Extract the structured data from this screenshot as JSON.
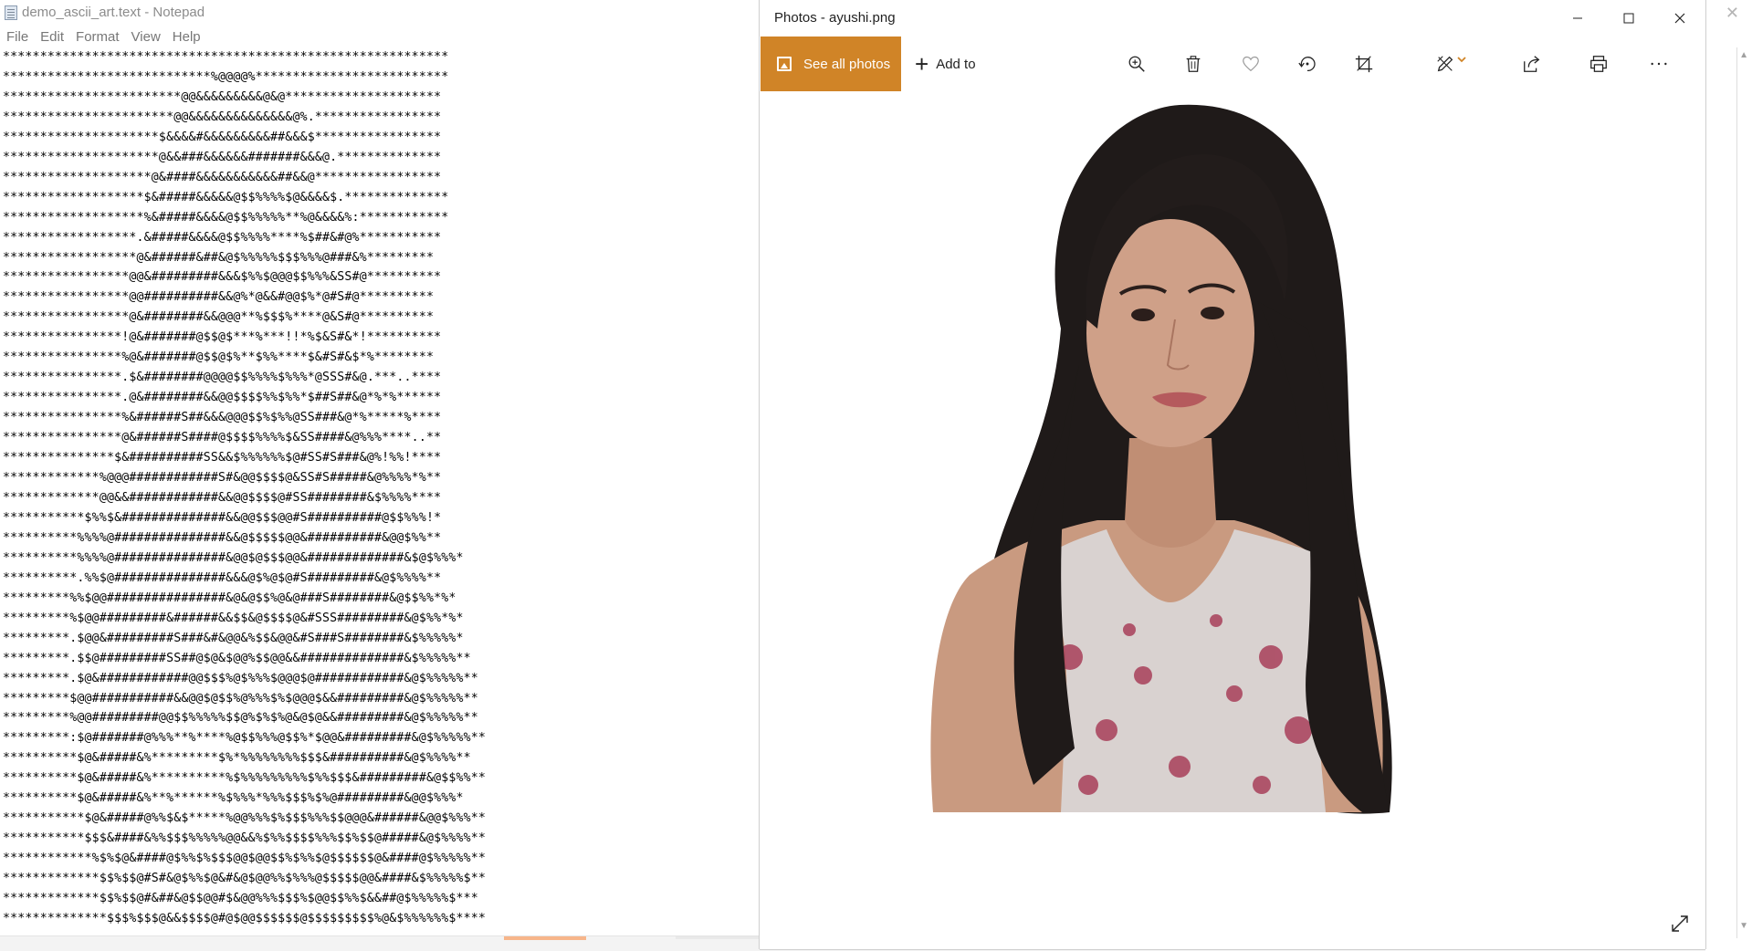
{
  "notepad": {
    "title": "demo_ascii_art.text - Notepad",
    "menu": [
      "File",
      "Edit",
      "Format",
      "View",
      "Help"
    ],
    "lines": [
      "************************************************************",
      "****************************%@@@@%**************************",
      "************************@@&&&&&&&&&@&@*********************",
      "***********************@@&&&&&&&&&&&&&&@%.*****************",
      "*********************$&&&&#&&&&&&&&&##&&&$*****************",
      "*********************@&&###&&&&&&#######&&&@.**************",
      "********************@&####&&&&&&&&&&&##&&@*****************",
      "*******************$&#####&&&&&@$$%%%%$@&&&&$.**************",
      "*******************%&#####&&&&@$$%%%%%**%@&&&&%:************",
      "******************.&#####&&&&@$$%%%%****%$##&#@%***********",
      "******************@&######&##&@$%%%%%$$$%%%@###&%*********",
      "*****************@@&#########&&&$%%$@@@$$%%%&SS#@**********",
      "*****************@@##########&&@%*@&&#@@$%*@#S#@**********",
      "*****************@&########&&@@@**%$$$%****@&S#@**********",
      "****************!@&#######@$$@$***%***!!*%$&S#&*!**********",
      "****************%@&#######@$$@$%**$%%****$&#S#&$*%********",
      "****************.$&########@@@@$$%%%%$%%%*@SSS#&@.***..****",
      "****************.@&########&&@@$$$$%%$%%*$##S##&@*%*%******",
      "****************%&######S##&&&@@@$$%$%%@SS###&@*%*****%****",
      "****************@&######S####@$$$$%%%%$&SS####&@%%%****..**",
      "***************$&##########SS&&$%%%%%%$@#SS#S###&@%!%%!****",
      "*************%@@@############S#&@@$$$$@&SS#S#####&@%%%%*%**",
      "*************@@&&############&&@@$$$$@#SS########&$%%%%****",
      "***********$%%$&##############&&@@$$$@@#S##########@$$%%%!*",
      "**********%%%%@###############&&@$$$$$@@&##########&@@$%%**",
      "**********%%%%@###############&@@$@$$$@@&#############&$@$%%%*",
      "**********.%%$@###############&&&@$%@$@#S#########&@$%%%%**",
      "*********%%$@@################&@&@$$%@&@###S########&@$$%%*%*",
      "*********%$@@#########&######&&$$&@$$$$@&#SSS#########&@$%%*%*",
      "*********.$@@&#########S###&#&@@&%$$&@@&#S###S########&$%%%%%*",
      "*********.$$@#########SS##@$@&$@@%$$@@&&##############&$%%%%%**",
      "*********.$@&############@@$$$%@$%%%$@@@$@############&@$%%%%%**",
      "*********$@@###########&&@@$@$$%@%%%$%$@@@$&&#########&@$%%%%%**",
      "*********%@@#########@@$$%%%%%$$@%$%$%@&@$@&&#########&@$%%%%%**",
      "*********:$@#######@%%%**%****%@$$%%%@$$%*$@@&#########&@$%%%%%**",
      "**********$@&#####&%*********$%*%%%%%%%%$$$&##########&@$%%%%**",
      "**********$@&#####&%**********%$%%%%%%%%%$%%$$$&#########&@$$%%**",
      "**********$@&#####&%**%******%$%%%*%%%$$$%$%@#########&@@$%%%*",
      "***********$@&#####@%%$&$*****%@@%%%$%$$$%%%$$@@@&######&@@$%%%**",
      "***********$$$&####&%%$$$%%%%%@@&&%$%%$$$$%%%$$%$$@#####&@$%%%%**",
      "************%$%$@&####@$%%$%$$$@@$@@$$%$%%$@$$$$$$@&####@$%%%%%**",
      "*************$$%$$@#S#&@$%%$@&#&@$@@%%$%%%@$$$$$@@&####&$%%%%%$**",
      "*************$$%$$@#&##&@$$@@#$&@@%%%$$$%$@@$$%%$&&##@$%%%%%$***",
      "**************$$$%$$$@&&$$$$@#@$@@$$$$$$@$$$$$$$$$%@&$%%%%%%$****"
    ]
  },
  "photos": {
    "title": "Photos - ayushi.png",
    "see_all_label": "See all photos",
    "add_to_label": "Add to",
    "accent_color": "#d08427",
    "toolbar_icons": [
      "zoom-in-icon",
      "delete-icon",
      "heart-icon",
      "rotate-icon",
      "crop-icon",
      "edit-draw-icon",
      "share-icon",
      "print-icon",
      "more-icon"
    ]
  }
}
